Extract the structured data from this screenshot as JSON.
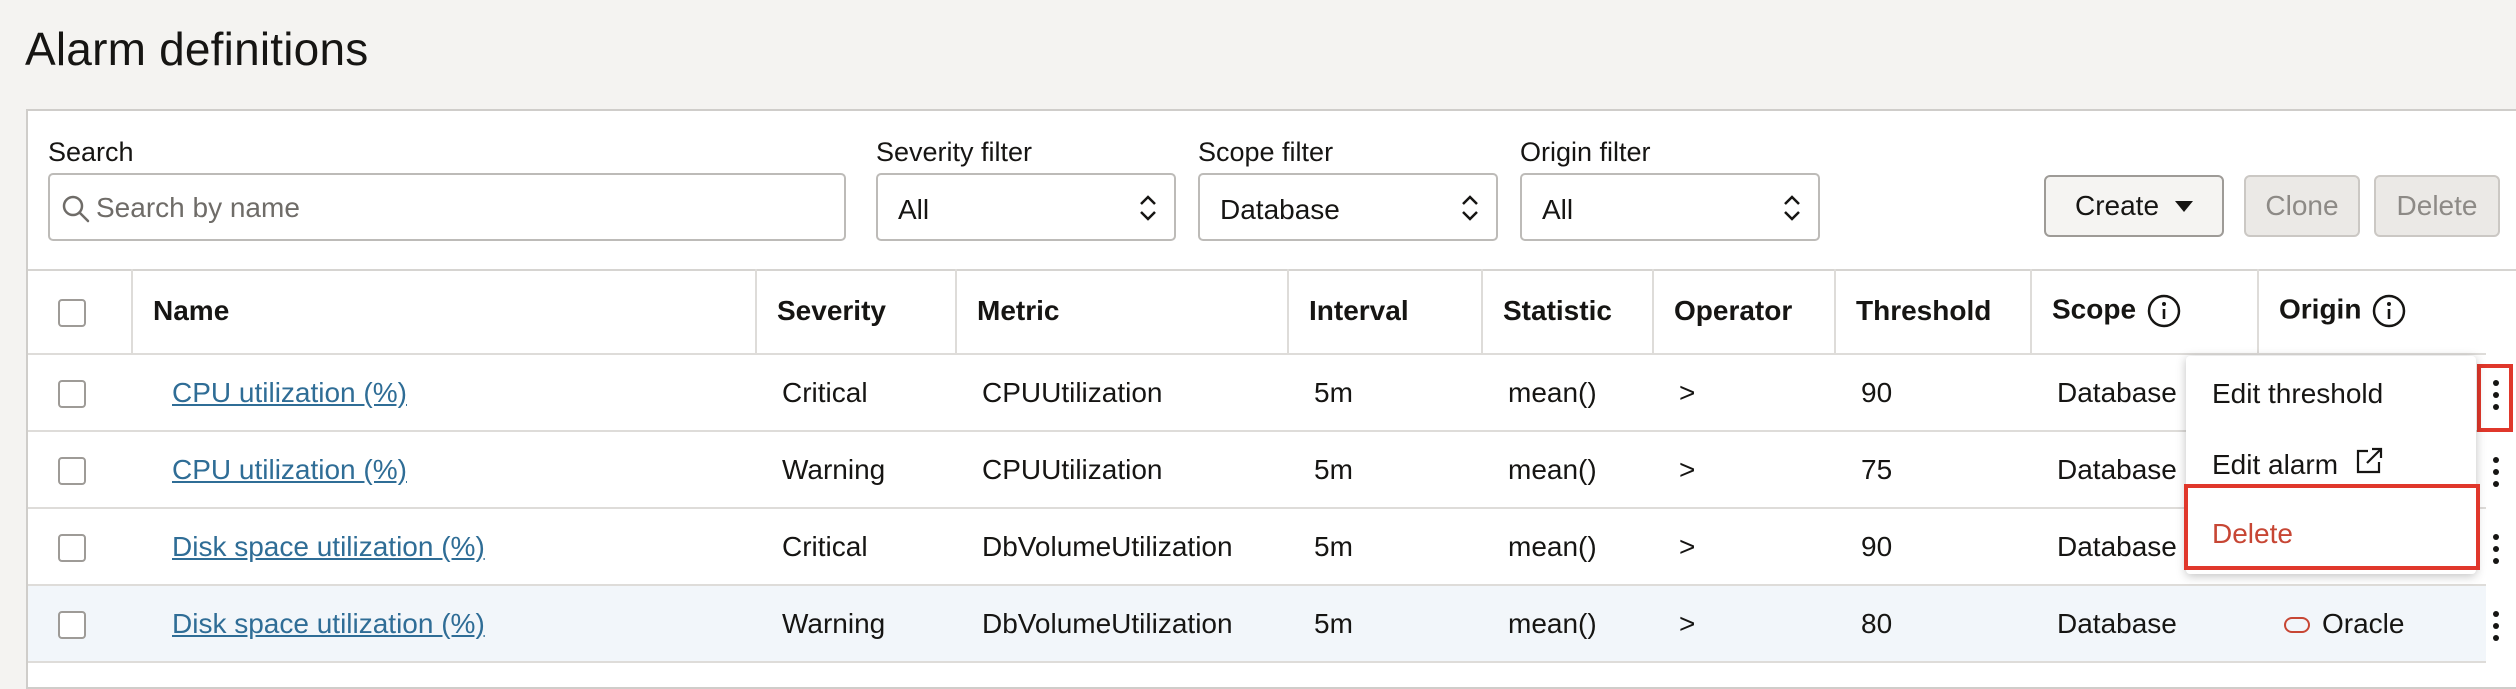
{
  "page": {
    "title": "Alarm definitions"
  },
  "toolbar": {
    "search_label": "Search",
    "search_placeholder": "Search by name",
    "severity_label": "Severity filter",
    "severity_value": "All",
    "scope_label": "Scope filter",
    "scope_value": "Database",
    "origin_label": "Origin filter",
    "origin_value": "All",
    "create_label": "Create",
    "clone_label": "Clone",
    "delete_label": "Delete"
  },
  "table": {
    "headers": {
      "name": "Name",
      "severity": "Severity",
      "metric": "Metric",
      "interval": "Interval",
      "statistic": "Statistic",
      "operator": "Operator",
      "threshold": "Threshold",
      "scope": "Scope",
      "origin": "Origin"
    },
    "rows": [
      {
        "name": "CPU utilization (%)",
        "severity": "Critical",
        "metric": "CPUUtilization",
        "interval": "5m",
        "statistic": "mean()",
        "operator": ">",
        "threshold": "90",
        "scope": "Database",
        "origin": ""
      },
      {
        "name": "CPU utilization (%)",
        "severity": "Warning",
        "metric": "CPUUtilization",
        "interval": "5m",
        "statistic": "mean()",
        "operator": ">",
        "threshold": "75",
        "scope": "Database",
        "origin": ""
      },
      {
        "name": "Disk space utilization (%)",
        "severity": "Critical",
        "metric": "DbVolumeUtilization",
        "interval": "5m",
        "statistic": "mean()",
        "operator": ">",
        "threshold": "90",
        "scope": "Database",
        "origin": ""
      },
      {
        "name": "Disk space utilization (%)",
        "severity": "Warning",
        "metric": "DbVolumeUtilization",
        "interval": "5m",
        "statistic": "mean()",
        "operator": ">",
        "threshold": "80",
        "scope": "Database",
        "origin": "Oracle"
      }
    ]
  },
  "context_menu": {
    "edit_threshold": "Edit threshold",
    "edit_alarm": "Edit alarm",
    "delete": "Delete"
  },
  "colors": {
    "link": "#2f6d96",
    "danger": "#c74634",
    "highlight": "#e0372b",
    "alt_row": "#f2f6fa"
  }
}
